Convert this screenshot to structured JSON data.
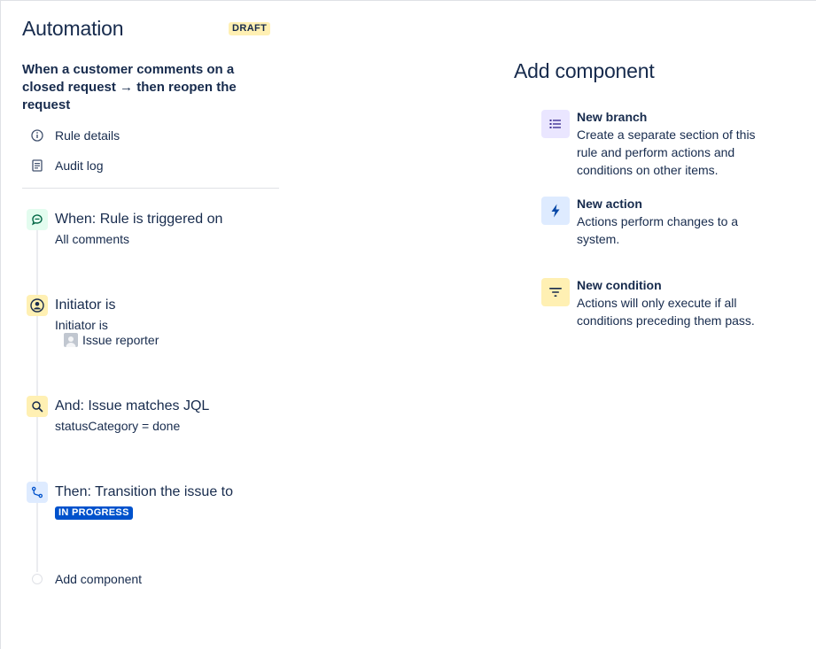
{
  "header": {
    "title": "Automation",
    "badge": "DRAFT"
  },
  "rule": {
    "title": "When a customer comments on a closed request → then reopen the request",
    "links": [
      {
        "label": "Rule details",
        "icon": "info-icon"
      },
      {
        "label": "Audit log",
        "icon": "document-icon"
      }
    ]
  },
  "steps": [
    {
      "title": "When: Rule is triggered on",
      "detail": "All comments",
      "icon": "comment-icon",
      "color": "#e3fcef"
    },
    {
      "title": "Initiator is",
      "detail": "Initiator is",
      "value": "Issue reporter",
      "icon": "person-icon",
      "color": "#fff0b3"
    },
    {
      "title": "And: Issue matches JQL",
      "detail": "statusCategory = done",
      "icon": "search-icon",
      "color": "#fff0b3"
    },
    {
      "title": "Then: Transition the issue to",
      "status": "IN PROGRESS",
      "icon": "transition-icon",
      "color": "#deebff"
    }
  ],
  "add_component_link": "Add component",
  "panel": {
    "title": "Add component",
    "items": [
      {
        "title": "New branch",
        "desc": "Create a separate section of this rule and perform actions and conditions on other items.",
        "icon": "list-icon",
        "color": "#eae6ff"
      },
      {
        "title": "New action",
        "desc": "Actions perform changes to a system.",
        "icon": "lightning-icon",
        "color": "#deebff"
      },
      {
        "title": "New condition",
        "desc": "Actions will only execute if all conditions preceding them pass.",
        "icon": "filter-icon",
        "color": "#fff0b3"
      }
    ]
  }
}
